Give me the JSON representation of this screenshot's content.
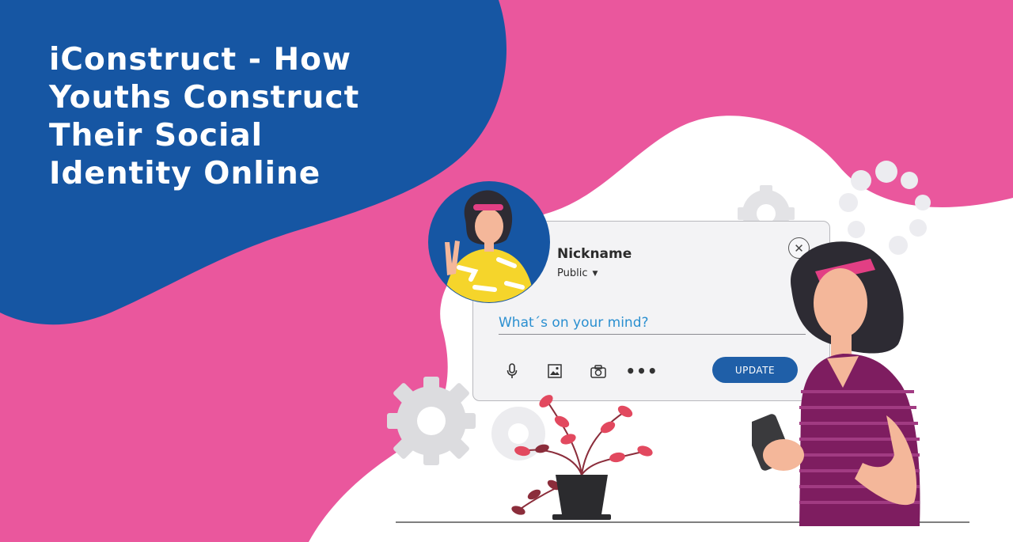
{
  "title_lines": [
    "iConstruct - How",
    "Youths Construct",
    "Their Social",
    "Identity Online"
  ],
  "post_card": {
    "nickname": "Nickname",
    "visibility": "Public",
    "placeholder": "What´s on your mind?",
    "update_label": "UPDATE",
    "toolbar_icons": [
      "microphone-icon",
      "image-icon",
      "camera-icon",
      "more-icon"
    ]
  },
  "colors": {
    "background": "#ea579d",
    "title_blob": "#1656a3",
    "update_button": "#1f5fa8",
    "placeholder_text": "#2a8fd0"
  }
}
